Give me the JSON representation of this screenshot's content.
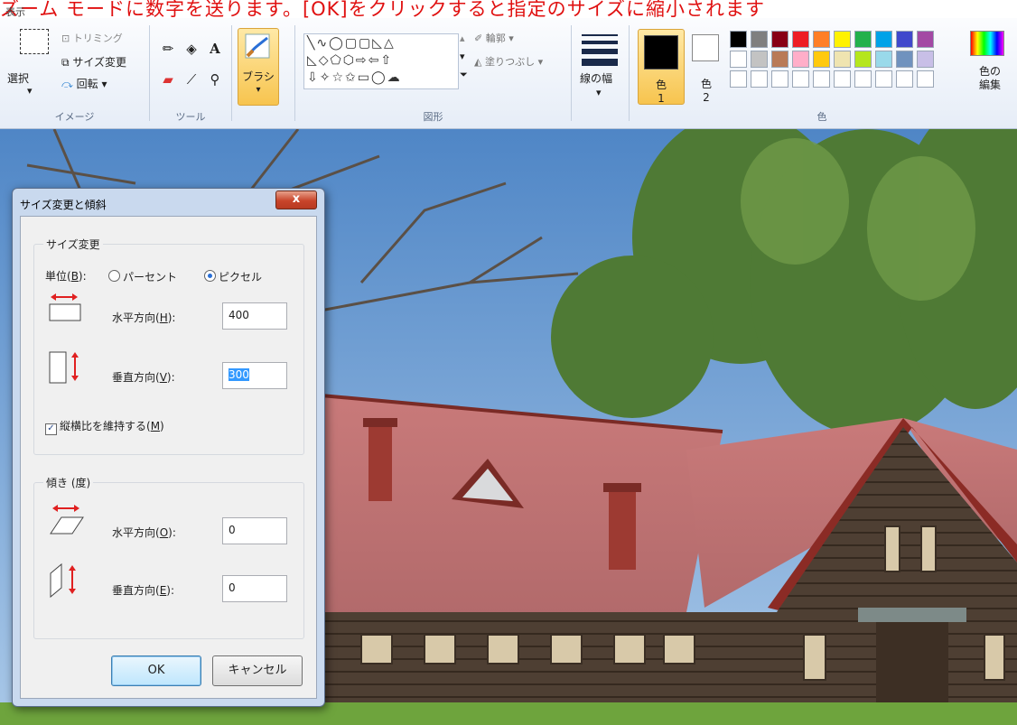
{
  "caption": {
    "text": "ズーム モードに数字を送ります。[OK]をクリックすると指定のサイズに縮小されます",
    "tab_label": "表示"
  },
  "ribbon": {
    "image_group": {
      "label": "イメージ",
      "select": "選択",
      "trim": "トリミング",
      "resize": "サイズ変更",
      "rotate": "回転 ▾"
    },
    "tools_group": {
      "label": "ツール"
    },
    "brush": {
      "label": "ブラシ"
    },
    "shapes_group": {
      "label": "図形",
      "outline": "輪郭 ▾",
      "fill": "塗りつぶし ▾",
      "row1": "╲∿◯▢▢◺△",
      "row2": "◺◇⬠⬡⇨⇦⇧",
      "row3": "⇩✧☆✩▭◯☁"
    },
    "line_width": {
      "label": "線の幅"
    },
    "color1": {
      "label": "色",
      "num": "1",
      "color": "#000000"
    },
    "color2": {
      "label": "色",
      "num": "2",
      "color": "#ffffff"
    },
    "colors_group": {
      "label": "色"
    },
    "palette_row1": [
      "#000000",
      "#7f7f7f",
      "#880015",
      "#ed1c24",
      "#ff7f27",
      "#fff200",
      "#22b14c",
      "#00a2e8",
      "#3f48cc",
      "#a349a4"
    ],
    "palette_row2": [
      "#ffffff",
      "#c3c3c3",
      "#b97a57",
      "#ffaec9",
      "#ffc90e",
      "#efe4b0",
      "#b5e61d",
      "#99d9ea",
      "#7092be",
      "#c8bfe7"
    ],
    "edit_colors": {
      "line1": "色の",
      "line2": "編集"
    }
  },
  "dialog": {
    "title": "サイズ変更と傾斜",
    "close_glyph": "x",
    "resize_section": {
      "legend": "サイズ変更",
      "unit_label": "単位(B):",
      "unit_label_plain": "単位(",
      "unit_label_key": "B",
      "unit_label_end": "):",
      "percent": "パーセント",
      "pixel": "ピクセル",
      "selected_unit": "ピクセル",
      "horizontal_label_pre": "水平方向(",
      "horizontal_key": "H",
      "horizontal_label_post": "):",
      "horizontal_value": "400",
      "vertical_label_pre": "垂直方向(",
      "vertical_key": "V",
      "vertical_label_post": "):",
      "vertical_value": "300",
      "keep_ratio_pre": "縦横比を維持する(",
      "keep_ratio_key": "M",
      "keep_ratio_post": ")",
      "keep_ratio_checked": true
    },
    "skew_section": {
      "legend": "傾き (度)",
      "horizontal_label_pre": "水平方向(",
      "horizontal_key": "O",
      "horizontal_label_post": "):",
      "horizontal_value": "0",
      "vertical_label_pre": "垂直方向(",
      "vertical_key": "E",
      "vertical_label_post": "):",
      "vertical_value": "0"
    },
    "ok": "OK",
    "cancel": "キャンセル"
  }
}
